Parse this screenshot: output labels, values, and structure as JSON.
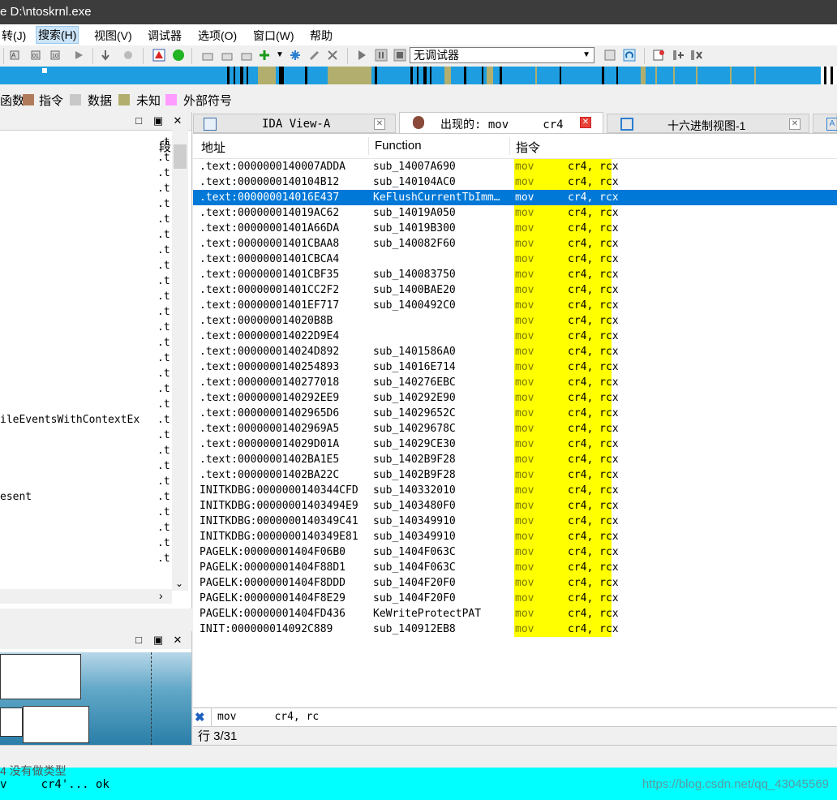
{
  "window": {
    "title": "e D:\\ntoskrnl.exe"
  },
  "menu": [
    {
      "label": "转(J)"
    },
    {
      "label": "搜索(H)",
      "active": true
    },
    {
      "label": "视图(V)"
    },
    {
      "label": "调试器"
    },
    {
      "label": "选项(O)"
    },
    {
      "label": "窗口(W)"
    },
    {
      "label": "帮助"
    }
  ],
  "toolbar": {
    "debugger_select": "无调试器"
  },
  "legend": [
    {
      "label": "函数",
      "color": "#f0f0f0"
    },
    {
      "label": "指令",
      "color": "#b07b5a"
    },
    {
      "label": "数据",
      "color": "#c8c8c8"
    },
    {
      "label": "未知",
      "color": "#b2ae6e"
    },
    {
      "label": "外部符号",
      "color": "#ff9cff"
    }
  ],
  "left_panel": {
    "header_col": "段",
    "rows": [
      {
        "name": "",
        "seg": ".t"
      },
      {
        "name": "",
        "seg": ".t"
      },
      {
        "name": "",
        "seg": ".t"
      },
      {
        "name": "",
        "seg": ".t"
      },
      {
        "name": "",
        "seg": ".t"
      },
      {
        "name": "",
        "seg": ".t"
      },
      {
        "name": "",
        "seg": ".t"
      },
      {
        "name": "",
        "seg": ".t"
      },
      {
        "name": "",
        "seg": ".t"
      },
      {
        "name": "",
        "seg": ".t"
      },
      {
        "name": "",
        "seg": ".t"
      },
      {
        "name": "",
        "seg": ".t"
      },
      {
        "name": "",
        "seg": ".t"
      },
      {
        "name": "",
        "seg": ".t"
      },
      {
        "name": "",
        "seg": ".t"
      },
      {
        "name": "",
        "seg": ".t"
      },
      {
        "name": "",
        "seg": ".t"
      },
      {
        "name": "",
        "seg": ".t"
      },
      {
        "name": "ileEventsWithContextEx",
        "seg": ".t"
      },
      {
        "name": "",
        "seg": ".t"
      },
      {
        "name": "",
        "seg": ".t"
      },
      {
        "name": "",
        "seg": ".t"
      },
      {
        "name": "",
        "seg": ".t"
      },
      {
        "name": "esent",
        "seg": ".t"
      },
      {
        "name": "",
        "seg": ".t"
      },
      {
        "name": "",
        "seg": ".t"
      },
      {
        "name": "",
        "seg": ".t"
      },
      {
        "name": "",
        "seg": ".t"
      }
    ]
  },
  "tabs": [
    {
      "label": "IDA View-A"
    },
    {
      "label": "出现的: mov     cr4",
      "active": true
    },
    {
      "label": "十六进制视图-1"
    }
  ],
  "columns": {
    "address": "地址",
    "function": "Function",
    "instruction": "指令"
  },
  "results": [
    {
      "addr": ".text:0000000140007ADDA",
      "func": "sub_14007A690",
      "op": "mov",
      "args": "cr4, rcx"
    },
    {
      "addr": ".text:0000000140104B12",
      "func": "sub_140104AC0",
      "op": "mov",
      "args": "cr4, rcx"
    },
    {
      "addr": ".text:000000014016E437",
      "func": "KeFlushCurrentTbImm…",
      "op": "mov",
      "args": "cr4, rcx",
      "selected": true
    },
    {
      "addr": ".text:000000014019AC62",
      "func": "sub_14019A050",
      "op": "mov",
      "args": "cr4, rcx"
    },
    {
      "addr": ".text:00000001401A66DA",
      "func": "sub_14019B300",
      "op": "mov",
      "args": "cr4, rcx"
    },
    {
      "addr": ".text:00000001401CBAA8",
      "func": "sub_140082F60",
      "op": "mov",
      "args": "cr4, rcx"
    },
    {
      "addr": ".text:00000001401CBCA4",
      "func": "",
      "op": "mov",
      "args": "cr4, rcx"
    },
    {
      "addr": ".text:00000001401CBF35",
      "func": "sub_140083750",
      "op": "mov",
      "args": "cr4, rcx"
    },
    {
      "addr": ".text:00000001401CC2F2",
      "func": "sub_1400BAE20",
      "op": "mov",
      "args": "cr4, rcx"
    },
    {
      "addr": ".text:00000001401EF717",
      "func": "sub_1400492C0",
      "op": "mov",
      "args": "cr4, rcx"
    },
    {
      "addr": ".text:000000014020B8B",
      "func": "",
      "op": "mov",
      "args": "cr4, rcx"
    },
    {
      "addr": ".text:000000014022D9E4",
      "func": "",
      "op": "mov",
      "args": "cr4, rcx"
    },
    {
      "addr": ".text:000000014024D892",
      "func": "sub_1401586A0",
      "op": "mov",
      "args": "cr4, rcx"
    },
    {
      "addr": ".text:0000000140254893",
      "func": "sub_14016E714",
      "op": "mov",
      "args": "cr4, rcx"
    },
    {
      "addr": ".text:0000000140277018",
      "func": "sub_140276EBC",
      "op": "mov",
      "args": "cr4, rcx"
    },
    {
      "addr": ".text:0000000140292EE9",
      "func": "sub_140292E90",
      "op": "mov",
      "args": "cr4, rcx"
    },
    {
      "addr": ".text:00000001402965D6",
      "func": "sub_14029652C",
      "op": "mov",
      "args": "cr4, rcx"
    },
    {
      "addr": ".text:00000001402969A5",
      "func": "sub_14029678C",
      "op": "mov",
      "args": "cr4, rcx"
    },
    {
      "addr": ".text:000000014029D01A",
      "func": "sub_14029CE30",
      "op": "mov",
      "args": "cr4, rcx"
    },
    {
      "addr": ".text:00000001402BA1E5",
      "func": "sub_1402B9F28",
      "op": "mov",
      "args": "cr4, rcx"
    },
    {
      "addr": ".text:00000001402BA22C",
      "func": "sub_1402B9F28",
      "op": "mov",
      "args": "cr4, rcx"
    },
    {
      "addr": "INITKDBG:0000000140344CFD",
      "func": "sub_140332010",
      "op": "mov",
      "args": "cr4, rcx"
    },
    {
      "addr": "INITKDBG:00000001403494E9",
      "func": "sub_1403480F0",
      "op": "mov",
      "args": "cr4, rcx"
    },
    {
      "addr": "INITKDBG:0000000140349C41",
      "func": "sub_140349910",
      "op": "mov",
      "args": "cr4, rcx"
    },
    {
      "addr": "INITKDBG:0000000140349E81",
      "func": "sub_140349910",
      "op": "mov",
      "args": "cr4, rcx"
    },
    {
      "addr": "PAGELK:00000001404F06B0",
      "func": "sub_1404F063C",
      "op": "mov",
      "args": "cr4, rcx"
    },
    {
      "addr": "PAGELK:00000001404F88D1",
      "func": "sub_1404F063C",
      "op": "mov",
      "args": "cr4, rcx"
    },
    {
      "addr": "PAGELK:00000001404F8DDD",
      "func": "sub_1404F20F0",
      "op": "mov",
      "args": "cr4, rcx"
    },
    {
      "addr": "PAGELK:00000001404F8E29",
      "func": "sub_1404F20F0",
      "op": "mov",
      "args": "cr4, rcx"
    },
    {
      "addr": "PAGELK:00000001404FD436",
      "func": "KeWriteProtectPAT",
      "op": "mov",
      "args": "cr4, rcx"
    },
    {
      "addr": "INIT:000000014092C889",
      "func": "sub_140912EB8",
      "op": "mov",
      "args": "cr4, rcx"
    }
  ],
  "search_text": "mov      cr4, rc",
  "status": {
    "row_count": "行 3/31"
  },
  "output": {
    "line1": "4  没有做类型",
    "line2": "v     cr4'... ok"
  },
  "watermark": "https://blog.csdn.net/qq_43045569"
}
